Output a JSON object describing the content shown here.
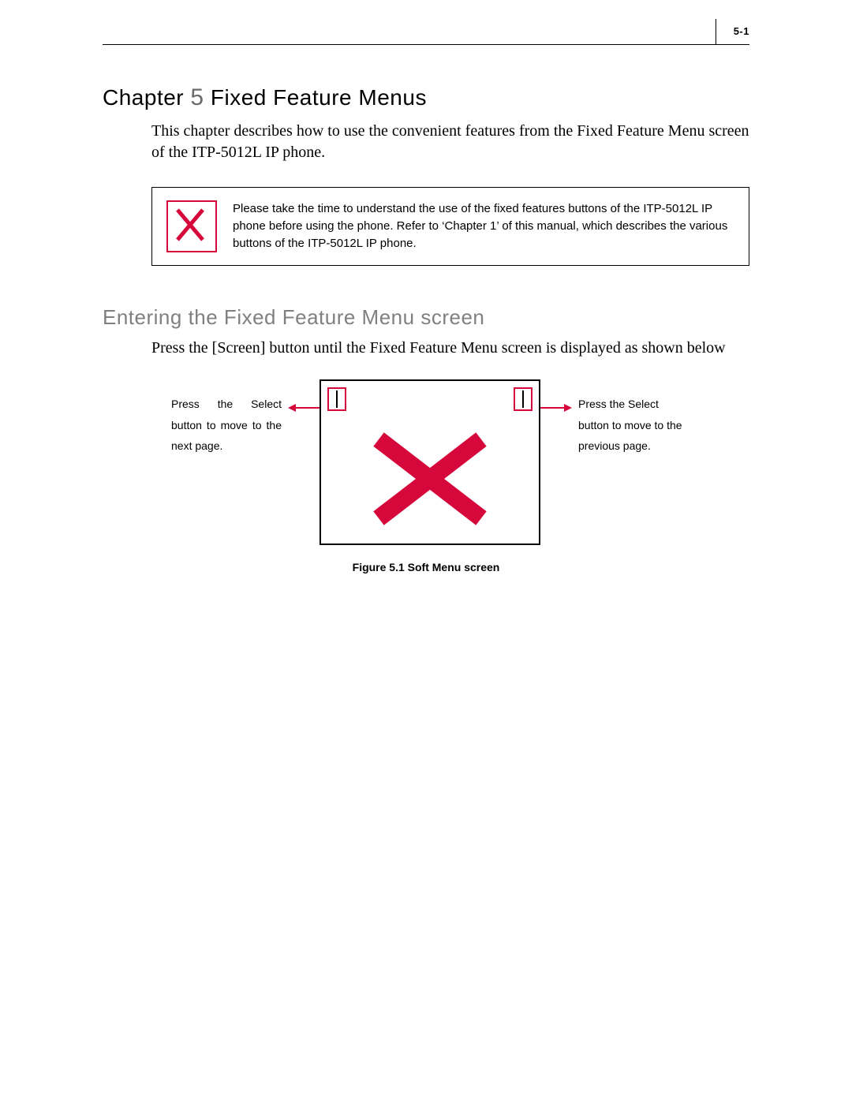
{
  "page_number": "5-1",
  "chapter_label": "Chapter",
  "chapter_number": "5",
  "chapter_title": "Fixed Feature Menus",
  "intro": "This chapter describes how to use the convenient features from the Fixed Feature Menu screen of the ITP-5012L IP phone.",
  "callout_text": "Please take the time to understand the use of the fixed features buttons of the ITP-5012L IP phone before using the phone. Refer to ‘Chapter 1’ of this manual, which describes the various buttons of the ITP-5012L IP phone.",
  "section_heading": "Entering the Fixed Feature Menu screen",
  "section_body": "Press the [Screen] button until the Fixed Feature Menu screen is displayed as shown below",
  "left_note": "Press the Select button to move to the next page.",
  "right_note": "Press the Select button to move to the previous page.",
  "figure_caption": "Figure 5.1   Soft Menu screen"
}
